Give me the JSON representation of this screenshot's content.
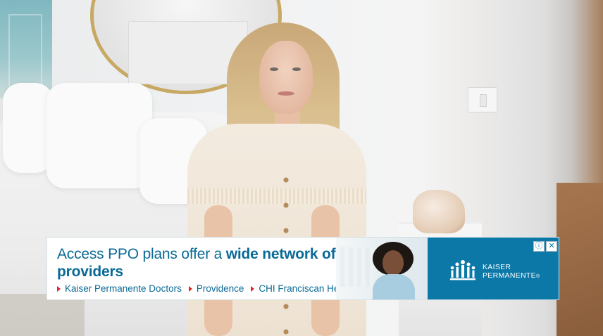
{
  "ad": {
    "headline_regular": "Access PPO plans offer a ",
    "headline_bold": "wide network of providers",
    "links": [
      {
        "label": "Kaiser Permanente Doctors"
      },
      {
        "label": "Providence"
      },
      {
        "label": "CHI Franciscan Health"
      }
    ],
    "brand_line1": "KAISER",
    "brand_line2": "PERMANENTE",
    "brand_mark": "®",
    "info_symbol": "ⓘ",
    "close_symbol": "✕",
    "colors": {
      "headline": "#0a6a96",
      "brand_panel": "#0b78a8",
      "link_arrow": "#d8272d"
    }
  }
}
